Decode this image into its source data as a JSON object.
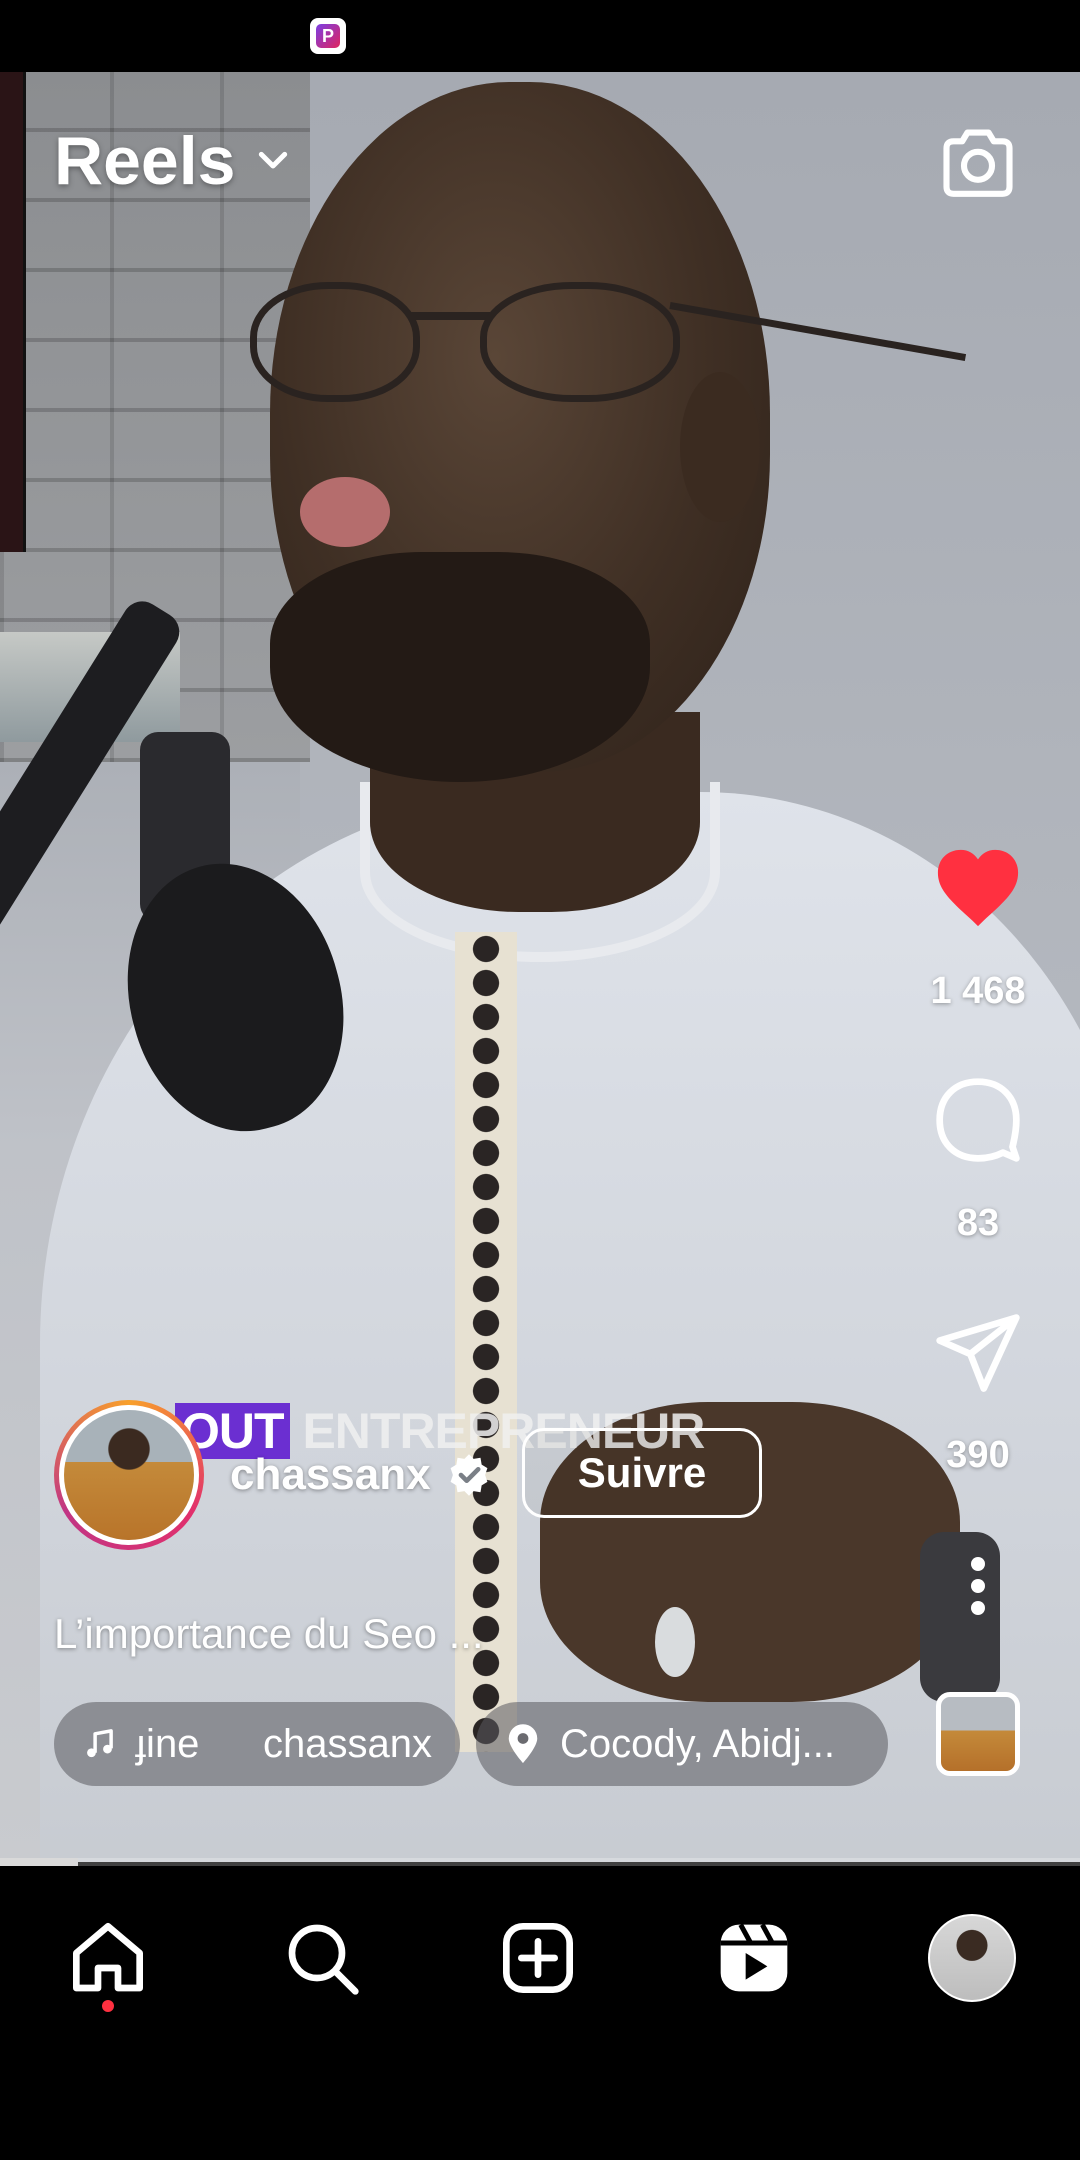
{
  "status_bar": {
    "app_icon": "p-app-icon"
  },
  "header": {
    "title": "Reels",
    "dropdown_icon": "chevron-down-icon",
    "camera_icon": "camera-icon"
  },
  "video": {
    "overlay_text_highlight": "OUT",
    "overlay_text_rest": " ENTREPRENEUR"
  },
  "actions": {
    "like": {
      "icon": "heart-filled-icon",
      "count": "1 468",
      "color": "#ff3040"
    },
    "comment": {
      "icon": "comment-icon",
      "count": "83"
    },
    "share": {
      "icon": "send-icon",
      "count": "390"
    },
    "more": {
      "icon": "more-vertical-icon"
    }
  },
  "author": {
    "username": "chassanx",
    "verified": true,
    "follow_label": "Suivre"
  },
  "caption": "L’importance du Seo ...",
  "chips": {
    "audio": {
      "icon": "music-note-icon",
      "text_a": "ɟine",
      "text_b": "chassanx"
    },
    "location": {
      "icon": "location-pin-icon",
      "text": "Cocody, Abidj..."
    }
  },
  "progress": {
    "fraction": 0.072
  },
  "bottom_nav": {
    "items": [
      {
        "name": "home",
        "icon": "home-icon",
        "active": true
      },
      {
        "name": "search",
        "icon": "search-icon"
      },
      {
        "name": "create",
        "icon": "add-square-icon"
      },
      {
        "name": "reels",
        "icon": "reels-icon"
      },
      {
        "name": "profile",
        "icon": "profile-avatar"
      }
    ],
    "notification_color": "#ff3040"
  }
}
